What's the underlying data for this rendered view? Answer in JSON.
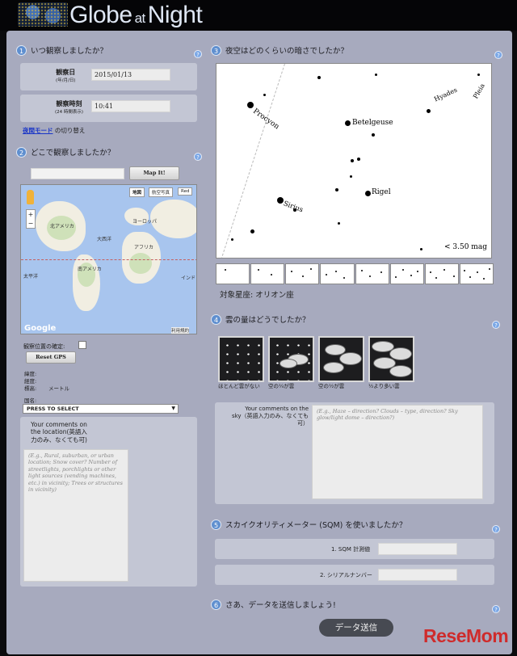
{
  "app": {
    "title_globe": "Globe",
    "title_at": "at",
    "title_night": "Night"
  },
  "section1": {
    "num": "1",
    "title": "いつ観察しましたか？",
    "date_label": "観察日",
    "date_sub": "(年/月/日)",
    "date_value": "2015/01/13",
    "time_label": "観察時刻",
    "time_sub": "(24 時間表示)",
    "time_value": "10:41",
    "night_mode_link": "夜間モード",
    "night_mode_rest": "の切り替え"
  },
  "section2": {
    "num": "2",
    "title": "どこで観察しましたか？",
    "map_it": "Map It!",
    "map_types": [
      "地図",
      "航空写真",
      "Red"
    ],
    "map_labels": [
      "北アメリカ",
      "ヨーロッパ",
      "大西洋",
      "アフリカ",
      "南アメリカ",
      "太平洋",
      "インド"
    ],
    "map_brand": "Google",
    "map_terms": "利用規約",
    "confirm_label": "観察位置の確定:",
    "reset_gps": "Reset GPS",
    "lat_label": "緯度:",
    "lon_label": "経度:",
    "elev_label": "標高:",
    "elev_unit": "メートル",
    "country_label": "国名:",
    "country_value": "PRESS TO SELECT",
    "comments_label_1": "Your comments on",
    "comments_label_2": "the location(英語入",
    "comments_label_3": "力のみ、なくても可)",
    "comments_placeholder": "(E.g., Rural, suburban, or urban location; Snow cover? Number of streetlights, porchlights or other light sources (vending machines, etc.) in vicinity; Trees or structures in vicinity)"
  },
  "section3": {
    "num": "3",
    "title": "夜空はどのくらいの暗さでしたか？",
    "stars": [
      "Procyon",
      "Betelgeuse",
      "Hyades",
      "Pleia",
      "Sirius",
      "Rigel"
    ],
    "mag_label": "< 3.50 mag",
    "constellation": "対象星座: オリオン座"
  },
  "section4": {
    "num": "4",
    "title": "雲の量はどうでしたか？",
    "options": [
      "ほとんど雲がない",
      "空の¼が雲",
      "空の½が雲",
      "½より多い雲"
    ],
    "sky_comments_1": "Your comments on the",
    "sky_comments_2": "sky（英語入力のみ、なくても",
    "sky_comments_3": "可）",
    "sky_placeholder": "(E.g., Haze – direction? Clouds – type, direction? Sky glow/light dome – direction?)"
  },
  "section5": {
    "num": "5",
    "title": "スカイクオリティメーター (SQM) を使いましたか？",
    "sqm_label": "1. SQM 計測値",
    "serial_label": "2. シリアルナンバー"
  },
  "section6": {
    "num": "6",
    "title": "さあ、データを送信しましょう!",
    "submit": "データ送信"
  },
  "watermark": "ReseMom"
}
